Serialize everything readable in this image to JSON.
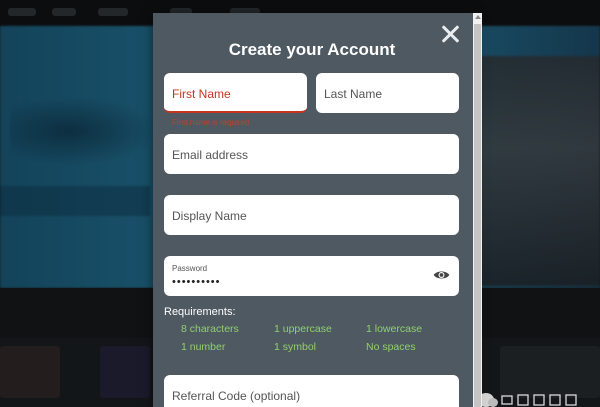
{
  "modal": {
    "title": "Create your Account",
    "close_icon": "close-icon"
  },
  "form": {
    "first_name": {
      "placeholder": "First Name",
      "error": "First name is required"
    },
    "last_name": {
      "placeholder": "Last Name"
    },
    "email": {
      "placeholder": "Email address"
    },
    "display_name": {
      "placeholder": "Display Name"
    },
    "password": {
      "label": "Password",
      "value": "••••••••••",
      "toggle_icon": "eye-icon"
    },
    "referral": {
      "placeholder": "Referral Code (optional)"
    }
  },
  "requirements": {
    "title": "Requirements:",
    "items": [
      "8 characters",
      "1 uppercase",
      "1 lowercase",
      "1 number",
      "1 symbol",
      "No spaces"
    ]
  },
  "colors": {
    "modal_bg": "#4f5962",
    "error": "#c6341f",
    "requirement_met": "#8fd16b"
  }
}
